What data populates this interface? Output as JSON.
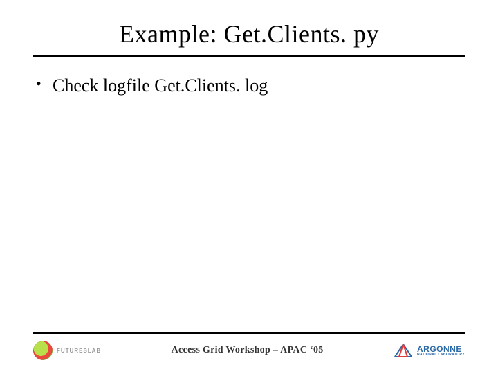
{
  "title": "Example: Get.Clients. py",
  "bullets": [
    "Check logfile Get.Clients. log"
  ],
  "footer": {
    "left_logo_text": "FUTURESLAB",
    "center": "Access Grid Workshop – APAC ‘05",
    "right_logo_main": "ARGONNE",
    "right_logo_sub": "NATIONAL LABORATORY"
  }
}
